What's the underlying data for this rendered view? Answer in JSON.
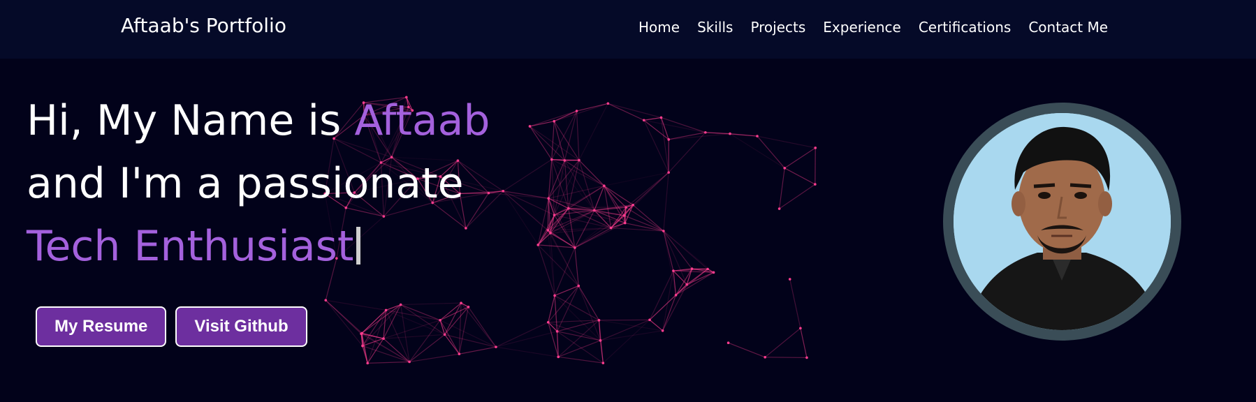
{
  "nav": {
    "brand": "Aftaab's Portfolio",
    "links": [
      "Home",
      "Skills",
      "Projects",
      "Experience",
      "Certifications",
      "Contact Me"
    ]
  },
  "hero": {
    "line1_prefix": "Hi, My Name is ",
    "name": "Aftaab",
    "line2": "and I'm a passionate",
    "role": "Tech Enthusiast",
    "buttons": {
      "resume": "My Resume",
      "github": "Visit Github"
    }
  },
  "colors": {
    "background": "#02021a",
    "navbar": "#050a28",
    "accent": "#a461dd",
    "button": "#6d2f9f",
    "network": "#ff3d8f",
    "avatar_ring": "#3a4d57"
  },
  "icons": {
    "avatar": "profile-photo",
    "background": "particle-network"
  }
}
